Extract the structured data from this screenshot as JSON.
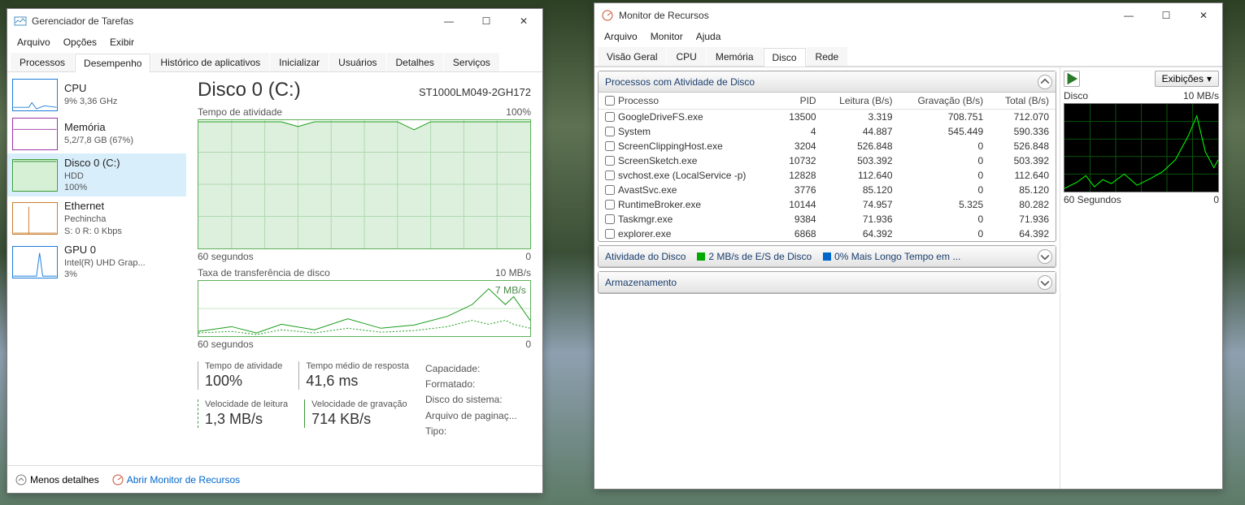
{
  "tm": {
    "title": "Gerenciador de Tarefas",
    "menu": [
      "Arquivo",
      "Opções",
      "Exibir"
    ],
    "tabs": [
      "Processos",
      "Desempenho",
      "Histórico de aplicativos",
      "Inicializar",
      "Usuários",
      "Detalhes",
      "Serviços"
    ],
    "active_tab": 1,
    "side": [
      {
        "title": "CPU",
        "sub1": "9% 3,36 GHz",
        "thumb": "blue"
      },
      {
        "title": "Memória",
        "sub1": "5,2/7,8 GB (67%)",
        "thumb": "purple"
      },
      {
        "title": "Disco 0 (C:)",
        "sub1": "HDD",
        "sub2": "100%",
        "thumb": "green"
      },
      {
        "title": "Ethernet",
        "sub1": "Pechincha",
        "sub2": "S: 0 R: 0 Kbps",
        "thumb": "orange"
      },
      {
        "title": "GPU 0",
        "sub1": "Intel(R) UHD Grap...",
        "sub2": "3%",
        "thumb": "blue"
      }
    ],
    "disk": {
      "name": "Disco 0 (C:)",
      "model": "ST1000LM049-2GH172",
      "chart1_label": "Tempo de atividade",
      "chart1_max": "100%",
      "chart2_label": "Taxa de transferência de disco",
      "chart2_max": "10 MB/s",
      "chart2_annot": "7 MB/s",
      "x_left": "60 segundos",
      "x_right": "0",
      "stats": [
        {
          "k": "Tempo de atividade",
          "v": "100%"
        },
        {
          "k": "Tempo médio de resposta",
          "v": "41,6 ms"
        },
        {
          "k": "Velocidade de leitura",
          "v": "1,3 MB/s"
        },
        {
          "k": "Velocidade de gravação",
          "v": "714 KB/s"
        }
      ],
      "caps": [
        "Capacidade:",
        "Formatado:",
        "Disco do sistema:",
        "Arquivo de paginaç...",
        "Tipo:"
      ]
    },
    "footer": {
      "less": "Menos detalhes",
      "open": "Abrir Monitor de Recursos"
    }
  },
  "rm": {
    "title": "Monitor de Recursos",
    "menu": [
      "Arquivo",
      "Monitor",
      "Ajuda"
    ],
    "tabs": [
      "Visão Geral",
      "CPU",
      "Memória",
      "Disco",
      "Rede"
    ],
    "active_tab": 3,
    "panel1": "Processos com Atividade de Disco",
    "cols": [
      "Processo",
      "PID",
      "Leitura (B/s)",
      "Gravação (B/s)",
      "Total (B/s)"
    ],
    "rows": [
      {
        "p": "GoogleDriveFS.exe",
        "pid": "13500",
        "r": "3.319",
        "w": "708.751",
        "t": "712.070"
      },
      {
        "p": "System",
        "pid": "4",
        "r": "44.887",
        "w": "545.449",
        "t": "590.336"
      },
      {
        "p": "ScreenClippingHost.exe",
        "pid": "3204",
        "r": "526.848",
        "w": "0",
        "t": "526.848"
      },
      {
        "p": "ScreenSketch.exe",
        "pid": "10732",
        "r": "503.392",
        "w": "0",
        "t": "503.392"
      },
      {
        "p": "svchost.exe (LocalService -p)",
        "pid": "12828",
        "r": "112.640",
        "w": "0",
        "t": "112.640"
      },
      {
        "p": "AvastSvc.exe",
        "pid": "3776",
        "r": "85.120",
        "w": "0",
        "t": "85.120"
      },
      {
        "p": "RuntimeBroker.exe",
        "pid": "10144",
        "r": "74.957",
        "w": "5.325",
        "t": "80.282"
      },
      {
        "p": "Taskmgr.exe",
        "pid": "9384",
        "r": "71.936",
        "w": "0",
        "t": "71.936"
      },
      {
        "p": "explorer.exe",
        "pid": "6868",
        "r": "64.392",
        "w": "0",
        "t": "64.392"
      }
    ],
    "panel2": "Atividade do Disco",
    "panel2_a": "2 MB/s de E/S de Disco",
    "panel2_b": "0% Mais Longo Tempo em ...",
    "panel3": "Armazenamento",
    "right": {
      "exib": "Exibições",
      "chart_title": "Disco",
      "chart_max": "10 MB/s",
      "chart_left": "60 Segundos",
      "chart_right": "0"
    }
  },
  "chart_data": [
    {
      "type": "line",
      "title": "Tempo de atividade",
      "ylim": [
        0,
        100
      ],
      "xlabel": "60 segundos",
      "series": [
        {
          "name": "active",
          "values": [
            100,
            100,
            98,
            100,
            100,
            96,
            100,
            100,
            100,
            100,
            100,
            100,
            100
          ]
        }
      ]
    },
    {
      "type": "line",
      "title": "Taxa de transferência de disco",
      "ylim": [
        0,
        10
      ],
      "xlabel": "60 segundos",
      "series": [
        {
          "name": "read",
          "values": [
            0.3,
            0.5,
            0.2,
            0.8,
            0.4,
            1.2,
            0.6,
            0.3,
            0.9,
            1.5,
            3.0,
            7.0,
            2.0
          ]
        },
        {
          "name": "write",
          "values": [
            0.2,
            0.3,
            0.2,
            0.5,
            0.3,
            0.4,
            0.3,
            0.2,
            0.4,
            0.7,
            0.8,
            1.0,
            0.7
          ]
        }
      ]
    },
    {
      "type": "line",
      "title": "Disco (Monitor)",
      "ylim": [
        0,
        10
      ],
      "xlabel": "60 Segundos",
      "series": [
        {
          "name": "io",
          "values": [
            0.2,
            0.5,
            1.0,
            0.3,
            0.8,
            0.4,
            1.5,
            0.6,
            0.9,
            2.0,
            4.0,
            8.0,
            3.0
          ]
        }
      ]
    }
  ]
}
